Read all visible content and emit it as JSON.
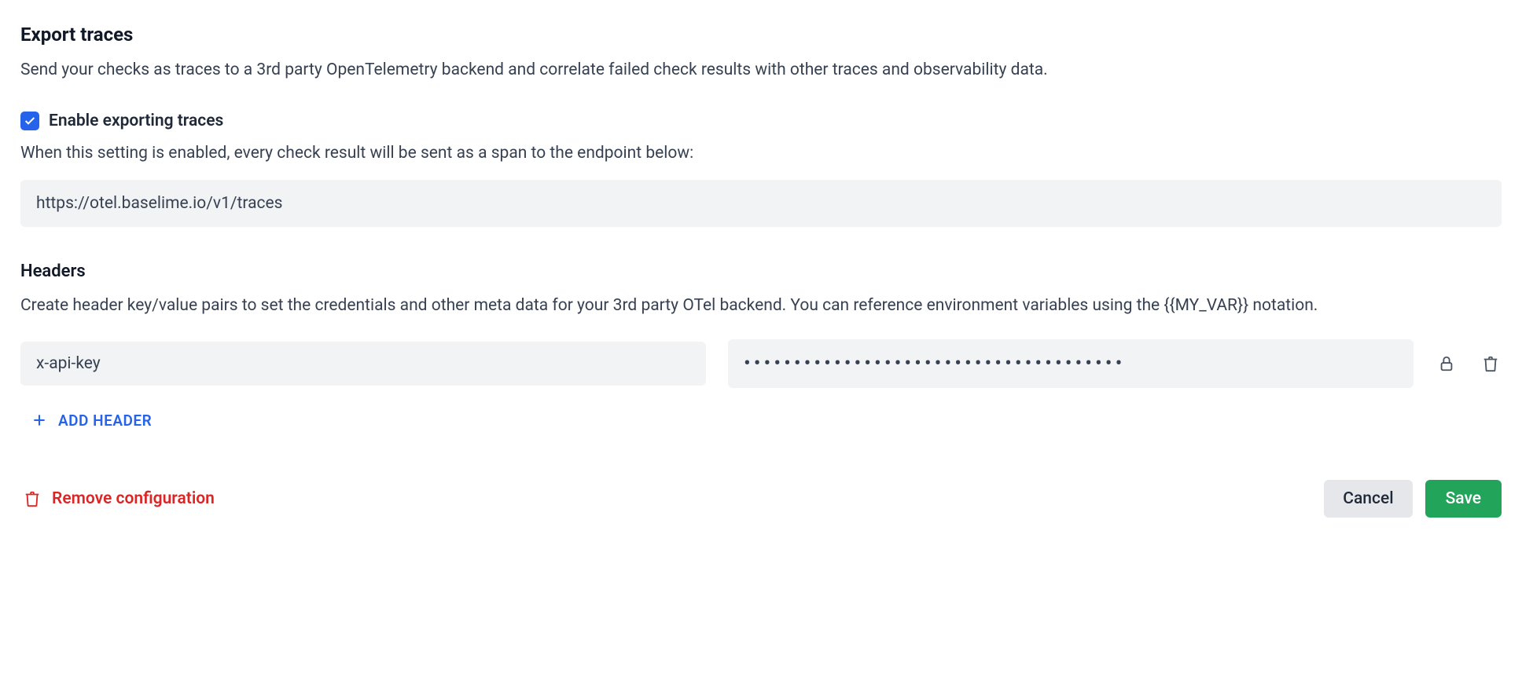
{
  "section": {
    "title": "Export traces",
    "description": "Send your checks as traces to a 3rd party OpenTelemetry backend and correlate failed check results with other traces and observability data."
  },
  "enable": {
    "checked": true,
    "label": "Enable exporting traces",
    "description": "When this setting is enabled, every check result will be sent as a span to the endpoint below:"
  },
  "endpoint": {
    "value": "https://otel.baselime.io/v1/traces"
  },
  "headers": {
    "title": "Headers",
    "description": "Create header key/value pairs to set the credentials and other meta data for your 3rd party OTel backend. You can reference environment variables using the {{MY_VAR}} notation.",
    "rows": [
      {
        "key": "x-api-key",
        "value_masked": "••••••••••••••••••••••••••••••••••••••"
      }
    ],
    "add_label": "ADD HEADER"
  },
  "footer": {
    "remove_label": "Remove configuration",
    "cancel_label": "Cancel",
    "save_label": "Save"
  }
}
